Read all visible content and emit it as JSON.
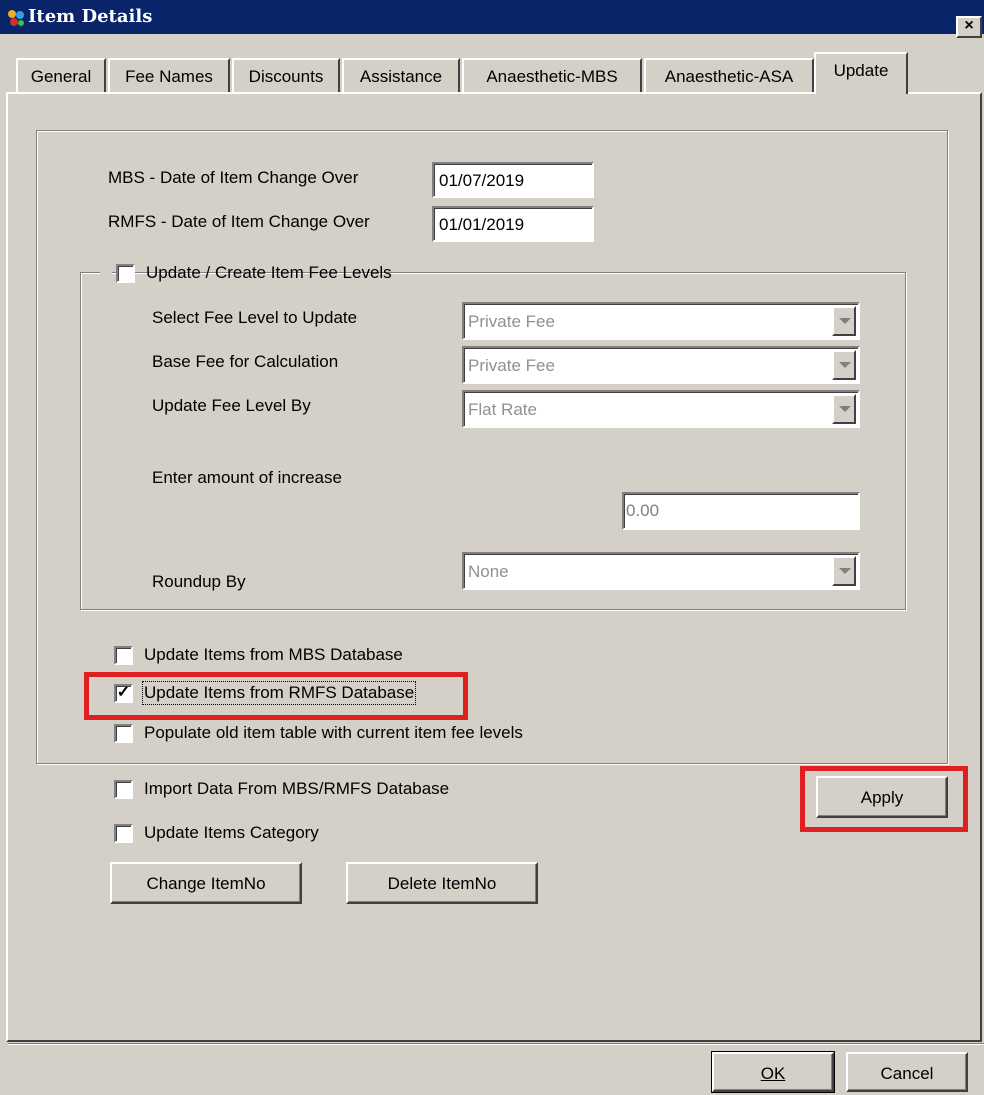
{
  "window": {
    "title": "Item Details",
    "close_label": "×"
  },
  "tabs": [
    {
      "label": "General"
    },
    {
      "label": "Fee Names"
    },
    {
      "label": "Discounts"
    },
    {
      "label": "Assistance"
    },
    {
      "label": "Anaesthetic-MBS"
    },
    {
      "label": "Anaesthetic-ASA"
    },
    {
      "label": "Update"
    }
  ],
  "dates": {
    "mbs_label": "MBS - Date of Item Change Over",
    "mbs_value": "01/07/2019",
    "rmfs_label": "RMFS - Date of Item Change Over",
    "rmfs_value": "01/01/2019"
  },
  "fee_levels": {
    "group_label": "Update / Create Item Fee Levels",
    "select_fee_level_label": "Select Fee Level to Update",
    "select_fee_level_value": "Private Fee",
    "base_fee_label": "Base Fee for Calculation",
    "base_fee_value": "Private Fee",
    "update_by_label": "Update Fee Level By",
    "update_by_value": "Flat Rate",
    "amount_label": "Enter amount of increase",
    "amount_value": "0.00",
    "roundup_label": "Roundup By",
    "roundup_value": "None"
  },
  "options": {
    "update_mbs_label": "Update Items from MBS Database",
    "update_rmfs_label": "Update Items from RMFS Database",
    "populate_old_label": "Populate old item table with current item fee levels",
    "import_label": "Import Data From MBS/RMFS Database",
    "update_category_label": "Update Items Category",
    "check_mark": "✓"
  },
  "buttons": {
    "apply": "Apply",
    "change_itemno": "Change ItemNo",
    "delete_itemno": "Delete ItemNo",
    "ok": "OK",
    "cancel": "Cancel"
  },
  "colors": {
    "title_bar": "#0a246a",
    "highlight": "#e02020",
    "face": "#d4d0c8"
  }
}
